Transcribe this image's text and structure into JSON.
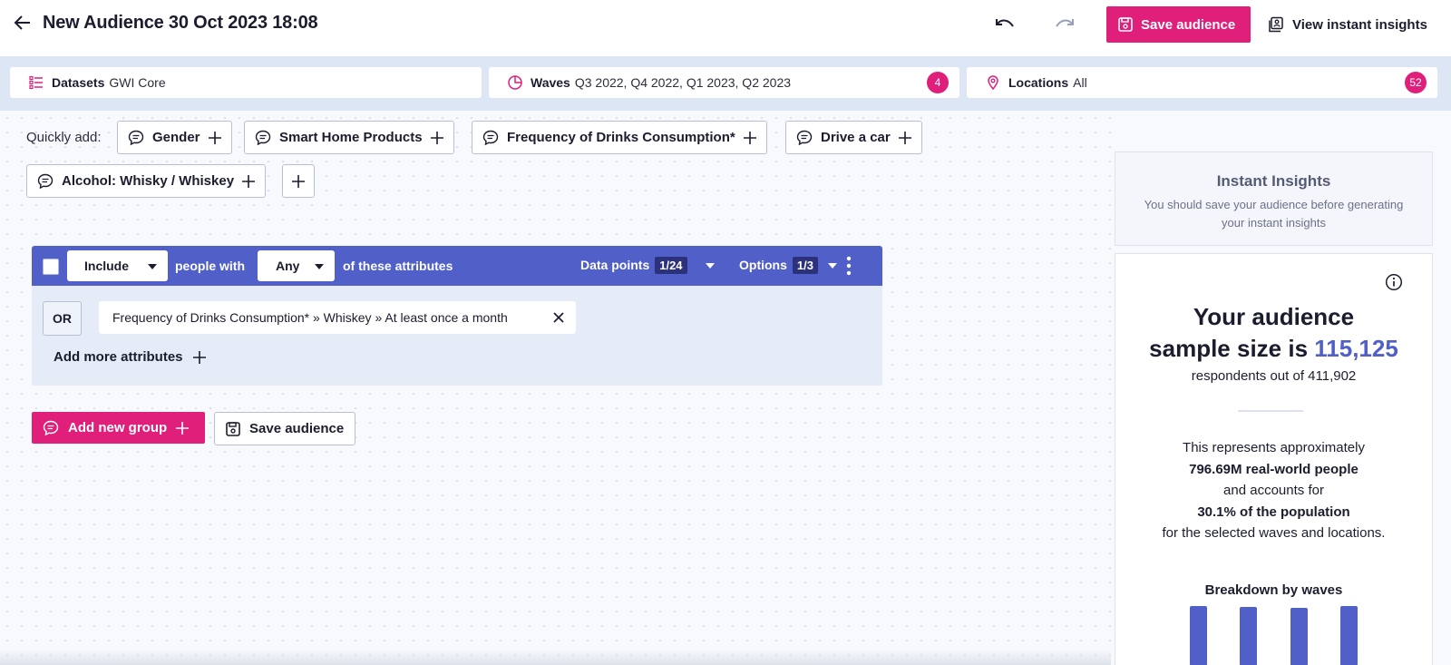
{
  "header": {
    "title": "New Audience 30 Oct 2023 18:08",
    "save_label": "Save audience",
    "view_insights_label": "View instant insights"
  },
  "filters": {
    "datasets": {
      "label": "Datasets",
      "value": "GWI Core"
    },
    "waves": {
      "label": "Waves",
      "value": "Q3 2022, Q4 2022, Q1 2023, Q2 2023",
      "count": "4"
    },
    "locations": {
      "label": "Locations",
      "value": "All",
      "count": "52"
    }
  },
  "quick_add": {
    "label": "Quickly add:",
    "items": [
      "Gender",
      "Smart Home Products",
      "Frequency of Drinks Consumption*",
      "Drive a car",
      "Alcohol: Whisky / Whiskey"
    ]
  },
  "group": {
    "mode": "Include",
    "people_with": "people with",
    "match": "Any",
    "of_these": "of these attributes",
    "data_points_label": "Data points",
    "data_points_value": "1/24",
    "options_label": "Options",
    "options_value": "1/3",
    "operator": "OR",
    "attribute": "Frequency of Drinks Consumption* » Whiskey » At least once a month",
    "add_more": "Add more attributes"
  },
  "actions": {
    "add_group": "Add new group",
    "save_audience": "Save audience"
  },
  "insights": {
    "title": "Instant Insights",
    "subtitle": "You should save your audience before generating your instant insights"
  },
  "audience": {
    "line1": "Your audience",
    "line2_prefix": "sample size is ",
    "sample_size": "115,125",
    "respondents": "respondents out of 411,902",
    "rep_line1": "This represents approximately",
    "rep_people": "796.69M real-world people",
    "rep_line3": "and accounts for",
    "rep_percent": "30.1% of the population",
    "rep_line5": "for the selected waves and locations.",
    "breakdown_title": "Breakdown by waves",
    "bar_color": "#5060c8"
  },
  "colors": {
    "accent": "#e01f7a",
    "primary": "#5060c8"
  }
}
